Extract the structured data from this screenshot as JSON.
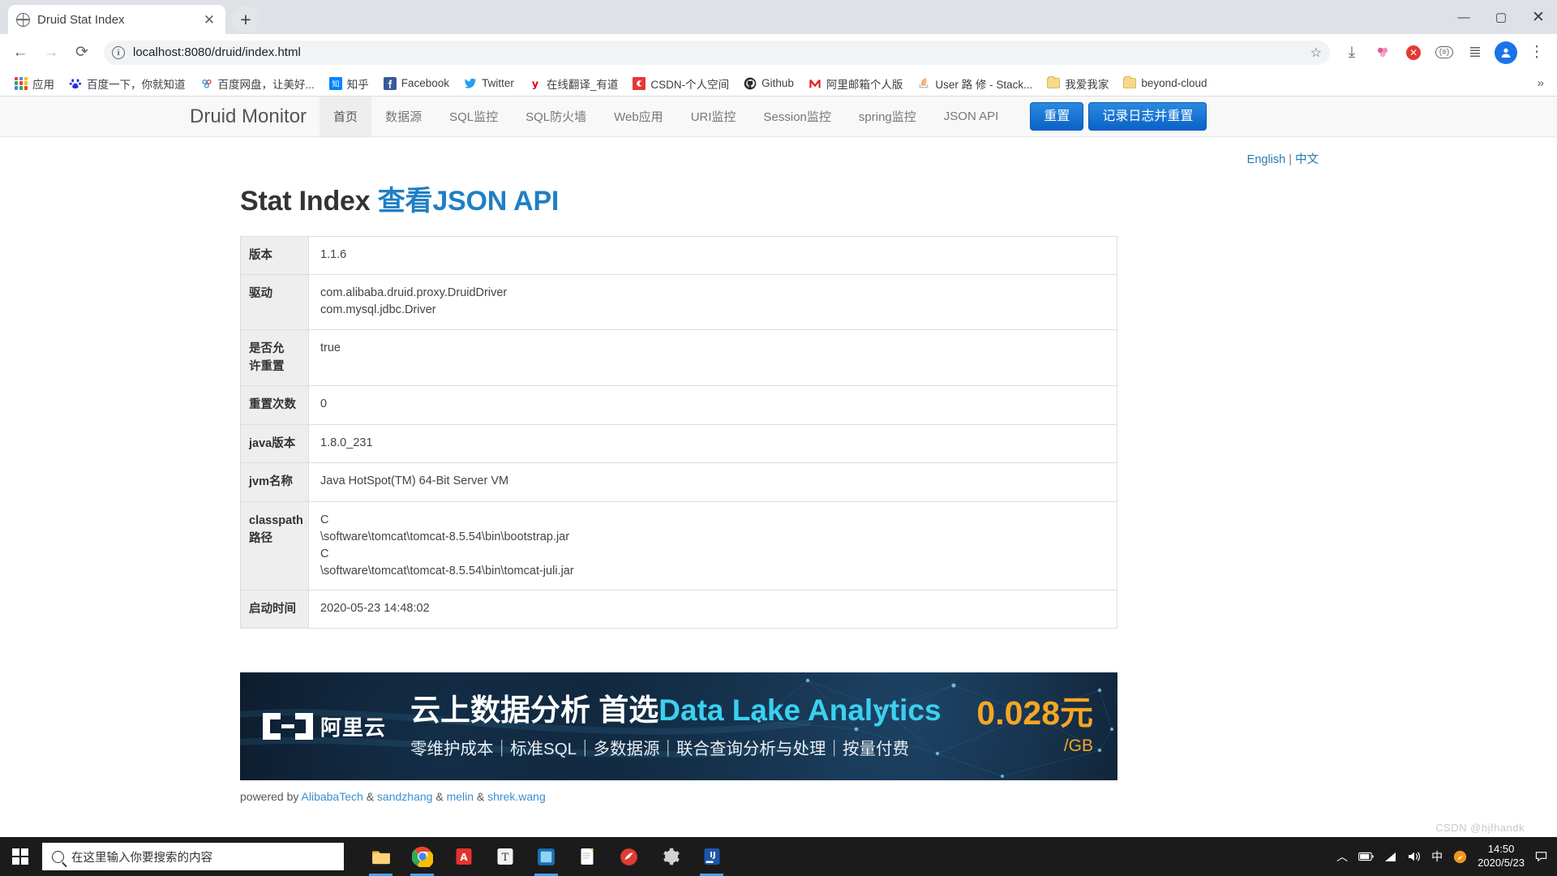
{
  "browser": {
    "tab": {
      "title": "Druid Stat Index",
      "favicon": "globe-icon",
      "close": "✕"
    },
    "newtab_label": "+",
    "window_controls": {
      "minimize": "—",
      "maximize": "▢",
      "close": "✕"
    },
    "toolbar": {
      "back": "←",
      "forward": "→",
      "reload": "⟳",
      "url": "localhost:8080/druid/index.html",
      "site_info": "i",
      "star": "☆",
      "download": "⤓",
      "extension_pink": "◈",
      "extension_blocked": "✕",
      "extension_pill": "(≡)",
      "reading_list": "≣",
      "profile_initial": "👤",
      "menu": "⋮"
    },
    "bookmarks": [
      {
        "label": "应用",
        "icon": "apps-grid-icon"
      },
      {
        "label": "百度一下，你就知道",
        "icon": "baidu-icon"
      },
      {
        "label": "百度网盘，让美好...",
        "icon": "baidu-pan-icon"
      },
      {
        "label": "知乎",
        "icon": "zhihu-icon"
      },
      {
        "label": "Facebook",
        "icon": "facebook-icon"
      },
      {
        "label": "Twitter",
        "icon": "twitter-icon"
      },
      {
        "label": "在线翻译_有道",
        "icon": "youdao-icon"
      },
      {
        "label": "CSDN-个人空间",
        "icon": "csdn-icon"
      },
      {
        "label": "Github",
        "icon": "github-icon"
      },
      {
        "label": "阿里邮箱个人版",
        "icon": "aliyun-mail-icon"
      },
      {
        "label": "User 路 修 - Stack...",
        "icon": "stackoverflow-icon"
      },
      {
        "label": "我爱我家",
        "icon": "folder-icon"
      },
      {
        "label": "beyond-cloud",
        "icon": "folder-icon"
      }
    ],
    "bookmarks_overflow": "»"
  },
  "page": {
    "brand": "Druid Monitor",
    "nav": [
      {
        "label": "首页",
        "active": true
      },
      {
        "label": "数据源",
        "active": false
      },
      {
        "label": "SQL监控",
        "active": false
      },
      {
        "label": "SQL防火墙",
        "active": false
      },
      {
        "label": "Web应用",
        "active": false
      },
      {
        "label": "URI监控",
        "active": false
      },
      {
        "label": "Session监控",
        "active": false
      },
      {
        "label": "spring监控",
        "active": false
      },
      {
        "label": "JSON API",
        "active": false
      }
    ],
    "nav_buttons": [
      {
        "label": "重置"
      },
      {
        "label": "记录日志并重置"
      }
    ],
    "lang": {
      "english": "English",
      "separator": "|",
      "chinese": "中文"
    },
    "title": "Stat Index",
    "title_link": "查看JSON API",
    "table": {
      "rows": [
        {
          "label": "版本",
          "values": [
            "1.1.6"
          ]
        },
        {
          "label": "驱动",
          "values": [
            "com.alibaba.druid.proxy.DruidDriver",
            "com.mysql.jdbc.Driver"
          ]
        },
        {
          "label": "是否允许重置",
          "values": [
            "true"
          ]
        },
        {
          "label": "重置次数",
          "values": [
            "0"
          ]
        },
        {
          "label": "java版本",
          "values": [
            "1.8.0_231"
          ]
        },
        {
          "label": "jvm名称",
          "values": [
            "Java HotSpot(TM) 64-Bit Server VM"
          ]
        },
        {
          "label": "classpath路径",
          "values": [
            "C",
            "\\software\\tomcat\\tomcat-8.5.54\\bin\\bootstrap.jar",
            "C",
            "\\software\\tomcat\\tomcat-8.5.54\\bin\\tomcat-juli.jar"
          ]
        },
        {
          "label": "启动时间",
          "values": [
            "2020-05-23 14:48:02"
          ]
        }
      ]
    },
    "banner": {
      "logo_text": "阿里云",
      "headline_cn": "云上数据分析 首选",
      "headline_en": "Data Lake Analytics",
      "subline": "零维护成本｜标准SQL｜多数据源｜联合查询分析与处理｜按量付费",
      "price": "0.028元",
      "price_unit": "/GB",
      "accent_color": "#3bd0f0",
      "price_color": "#f6a623"
    },
    "footer": {
      "prefix": "powered by",
      "credits": [
        "AlibabaTech",
        "sandzhang",
        "melin",
        "shrek.wang"
      ],
      "separator": "&"
    },
    "watermark": "CSDN @hjfhandk"
  },
  "taskbar": {
    "search_placeholder": "在这里输入你要搜索的内容",
    "apps": [
      {
        "name": "file-explorer-icon",
        "running": true
      },
      {
        "name": "chrome-icon",
        "running": true
      },
      {
        "name": "acrobat-reader-icon",
        "running": false
      },
      {
        "name": "typora-icon",
        "running": false
      },
      {
        "name": "vmware-icon",
        "running": true
      },
      {
        "name": "notepad-icon",
        "running": false
      },
      {
        "name": "navicat-icon",
        "running": false
      },
      {
        "name": "settings-icon",
        "running": false
      },
      {
        "name": "idea-icon",
        "running": true
      }
    ],
    "tray": {
      "chevron": "︿",
      "battery": "▭",
      "wifi": "◣",
      "volume": "🔊",
      "ime": "中",
      "sogou": "S"
    },
    "clock": {
      "time": "14:50",
      "date": "2020/5/23"
    },
    "notification": "▭"
  }
}
